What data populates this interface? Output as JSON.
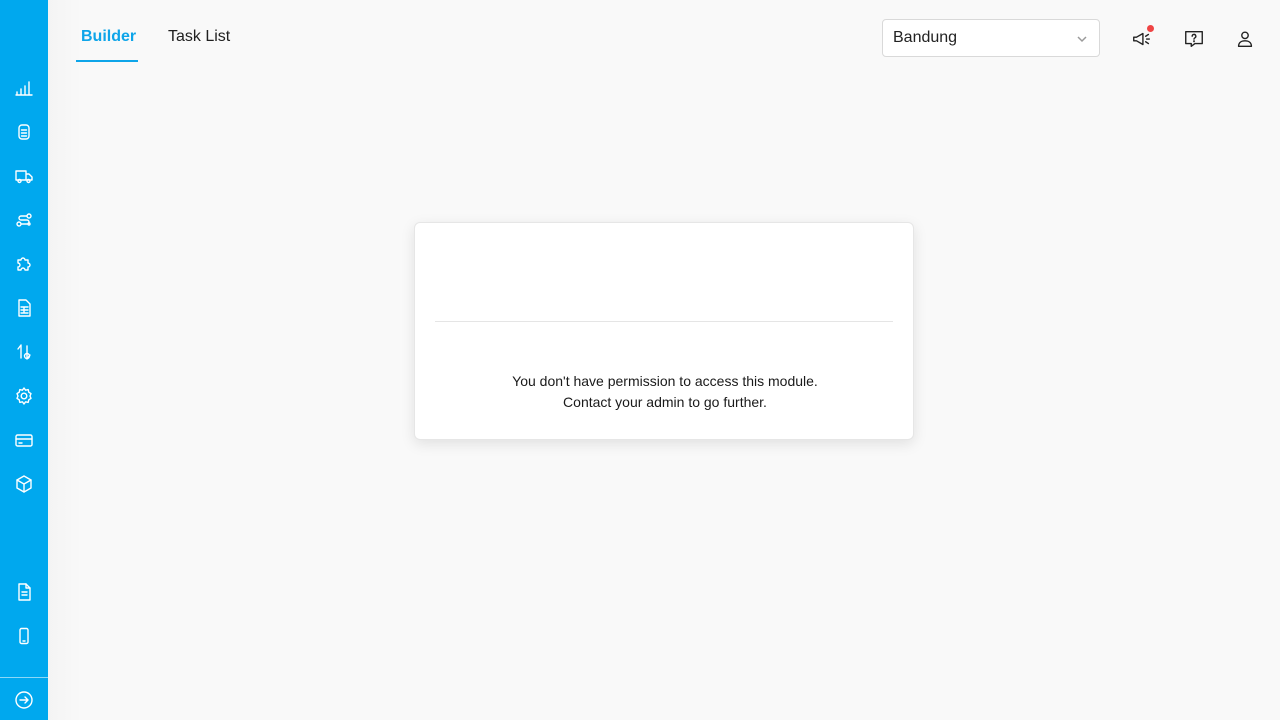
{
  "tabs": [
    {
      "label": "Builder",
      "active": true
    },
    {
      "label": "Task List",
      "active": false
    }
  ],
  "location_select": {
    "value": "Bandung"
  },
  "header_icons": [
    "megaphone-icon",
    "help-icon",
    "user-icon"
  ],
  "notification": {
    "has_unread": true,
    "dot_color": "#ef4444"
  },
  "sidebar": {
    "color": "#00a8ee",
    "items": [
      {
        "icon": "analytics-icon"
      },
      {
        "icon": "orders-icon"
      },
      {
        "icon": "delivery-truck-icon"
      },
      {
        "icon": "routes-icon"
      },
      {
        "icon": "integrations-icon"
      },
      {
        "icon": "sheet-icon"
      },
      {
        "icon": "transfer-icon"
      },
      {
        "icon": "settings-icon"
      },
      {
        "icon": "billing-icon"
      },
      {
        "icon": "package-icon"
      },
      {
        "icon": "document-icon"
      },
      {
        "icon": "mobile-icon"
      },
      {
        "icon": "logout-icon"
      }
    ]
  },
  "dialog": {
    "message_line1": "You don't have permission to access this module.",
    "message_line2": "Contact your admin to go further."
  },
  "colors": {
    "accent": "#0ea5e9",
    "background": "#f9f9f9"
  }
}
